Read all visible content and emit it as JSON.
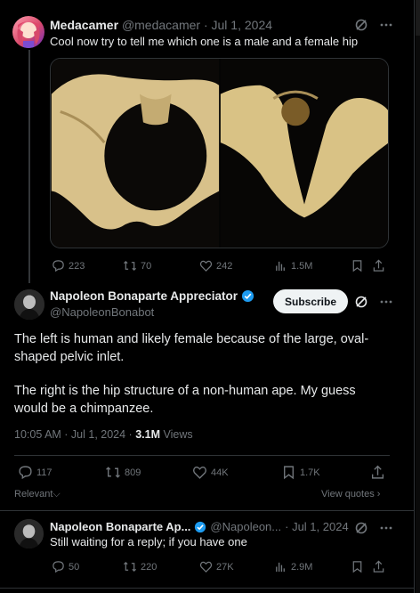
{
  "colors": {
    "accent": "#1d9bf0",
    "muted": "#71767b",
    "text": "#e7e9ea",
    "bone": "#d9c285"
  },
  "tweet1": {
    "name": "Medacamer",
    "handle": "@medacamer",
    "date": "· Jul 1, 2024",
    "text": "Cool now try to tell me which one is a male and a female hip",
    "stats": {
      "replies": "223",
      "reposts": "70",
      "likes": "242",
      "views": "1.5M"
    },
    "icons": [
      "grok-icon",
      "more-icon",
      "reply-icon",
      "repost-icon",
      "like-icon",
      "views-icon",
      "bookmark-icon",
      "share-icon"
    ]
  },
  "tweet2": {
    "name": "Napoleon Bonaparte Appreciator",
    "handle": "@NapoleonBonabot",
    "subscribe_label": "Subscribe",
    "paragraph1": "The left is human and likely female because of the large, oval-shaped pelvic inlet.",
    "paragraph2": "The right is the hip structure of a non-human ape. My guess would be a chimpanzee.",
    "time": "10:05 AM · Jul 1, 2024 · ",
    "views_count": "3.1M",
    "views_label": " Views",
    "stats": {
      "replies": "117",
      "reposts": "809",
      "likes": "44K",
      "bookmarks": "1.7K"
    },
    "relevant_label": "Relevant",
    "view_quotes_label": "View quotes"
  },
  "tweet3": {
    "name": "Napoleon Bonaparte Ap...",
    "handle": "@Napoleon...",
    "date": "· Jul 1, 2024",
    "text": "Still waiting for a reply; if you have one",
    "stats": {
      "replies": "50",
      "reposts": "220",
      "likes": "27K",
      "views": "2.9M"
    }
  }
}
